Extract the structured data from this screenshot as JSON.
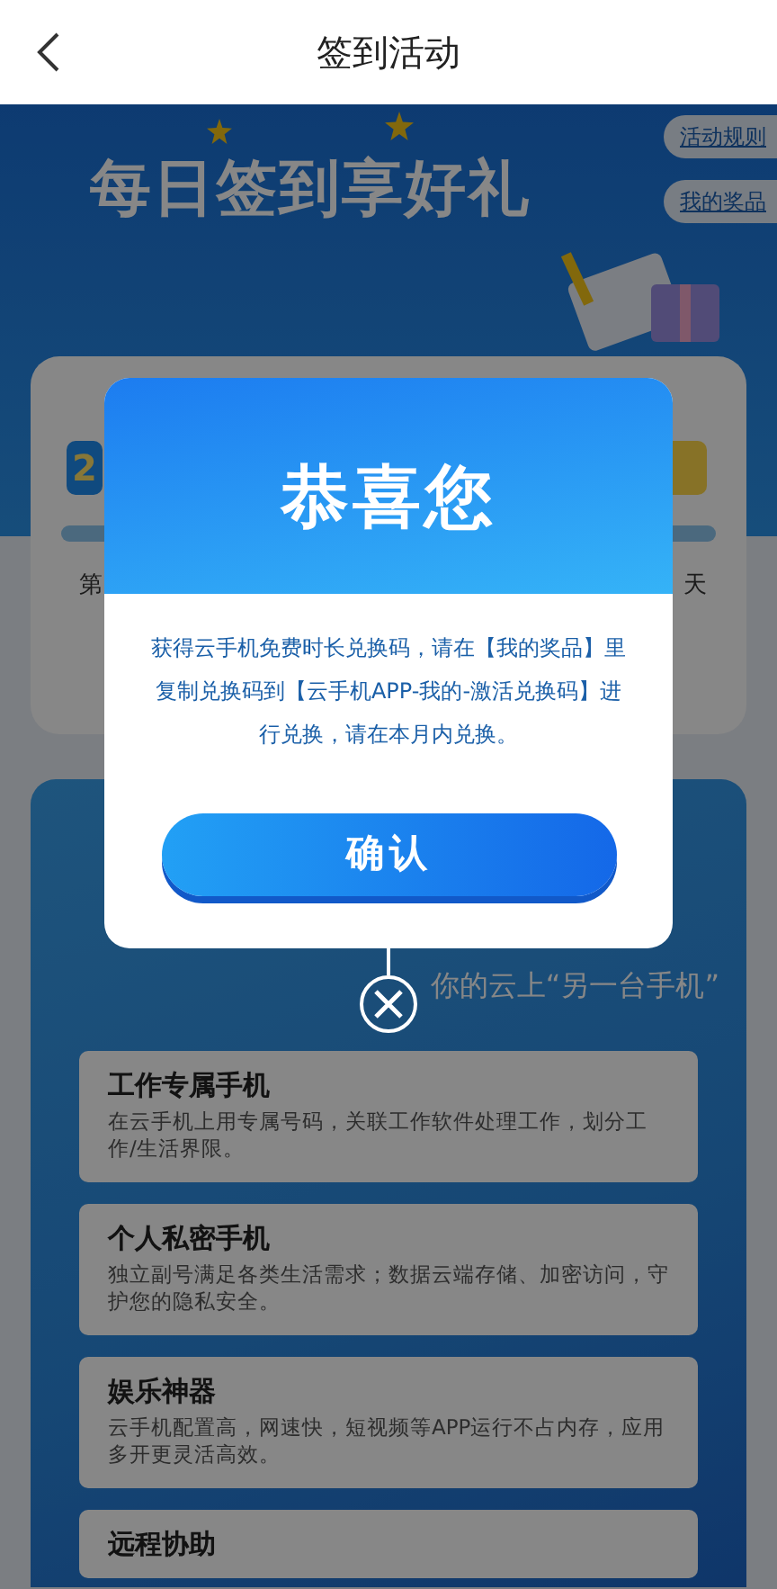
{
  "nav": {
    "title": "签到活动"
  },
  "banner": {
    "heading": "每日签到享好礼",
    "links": [
      "活动规则",
      "我的奖品"
    ]
  },
  "signin_card": {
    "day_badge": "2",
    "day_labels": [
      "第",
      "天"
    ]
  },
  "promo": {
    "subtitle": "你的云上“另一台手机”",
    "features": [
      {
        "title": "工作专属手机",
        "desc": "在云手机上用专属号码，关联工作软件处理工作，划分工作/生活界限。"
      },
      {
        "title": "个人私密手机",
        "desc": "独立副号满足各类生活需求；数据云端存储、加密访问，守护您的隐私安全。"
      },
      {
        "title": "娱乐神器",
        "desc": "云手机配置高，网速快，短视频等APP运行不占内存，应用多开更灵活高效。"
      },
      {
        "title": "远程协助"
      }
    ]
  },
  "dialog": {
    "title": "恭喜您",
    "message": "获得云手机免费时长兑换码，请在【我的奖品】里复制兑换码到【云手机APP-我的-激活兑换码】进行兑换，请在本月内兑换。",
    "confirm": "确认"
  }
}
